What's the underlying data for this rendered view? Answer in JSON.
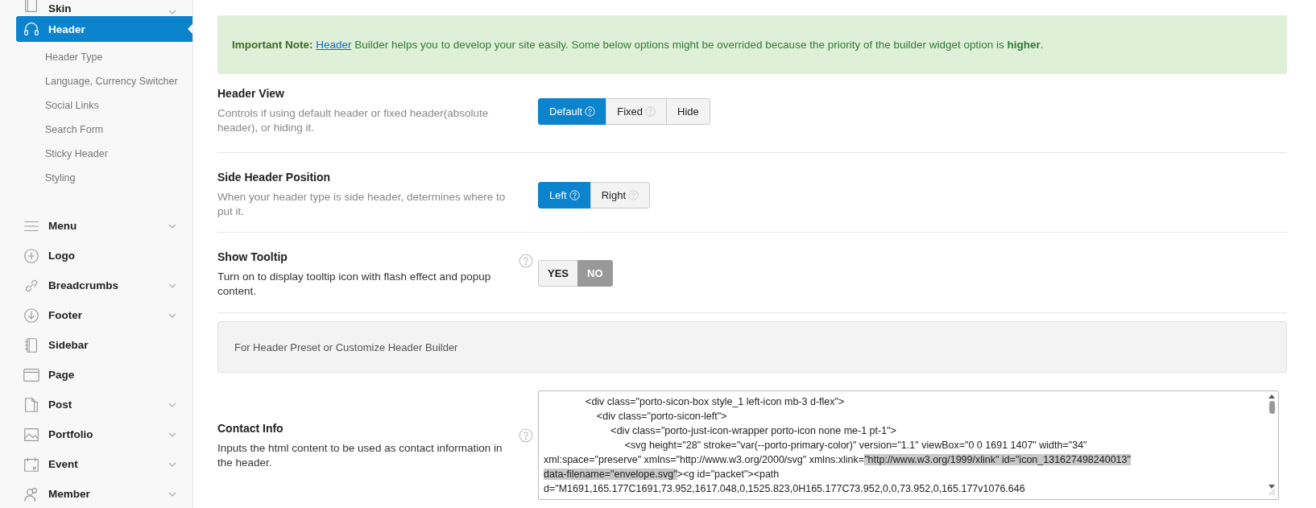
{
  "sidebar": {
    "items": [
      {
        "label": "Skin",
        "selected": false,
        "expandable": true
      },
      {
        "label": "Header",
        "selected": true,
        "expandable": false,
        "children": [
          {
            "label": "Header Type",
            "selected": false
          },
          {
            "label": "Language, Currency Switcher",
            "selected": false
          },
          {
            "label": "Social Links",
            "selected": false
          },
          {
            "label": "Search Form",
            "selected": false
          },
          {
            "label": "Sticky Header",
            "selected": false
          },
          {
            "label": "Styling",
            "selected": false
          }
        ]
      },
      {
        "label": "Menu",
        "selected": false,
        "expandable": true
      },
      {
        "label": "Logo",
        "selected": false,
        "expandable": false
      },
      {
        "label": "Breadcrumbs",
        "selected": false,
        "expandable": true
      },
      {
        "label": "Footer",
        "selected": false,
        "expandable": true
      },
      {
        "label": "Sidebar",
        "selected": false,
        "expandable": false
      },
      {
        "label": "Page",
        "selected": false,
        "expandable": false
      },
      {
        "label": "Post",
        "selected": false,
        "expandable": true
      },
      {
        "label": "Portfolio",
        "selected": false,
        "expandable": true
      },
      {
        "label": "Event",
        "selected": false,
        "expandable": true
      },
      {
        "label": "Member",
        "selected": false,
        "expandable": true
      }
    ]
  },
  "note": {
    "label": "Important Note:",
    "link": "Header",
    "text": "Builder helps you to develop your site easily. Some below options might be overrided because the priority of the builder widget option is **higher**."
  },
  "settings": [
    {
      "kind": "buttons",
      "title": "Header View",
      "description": "Controls if using default header or fixed header(absolute header), or hiding it.",
      "help": false,
      "options": [
        {
          "label": "Default",
          "help": true,
          "selected": true
        },
        {
          "label": "Fixed",
          "help": true,
          "selected": false
        },
        {
          "label": "Hide",
          "help": false,
          "selected": false
        }
      ]
    },
    {
      "kind": "buttons",
      "title": "Side Header Position",
      "description": "When your header type is side header, determines where to put it.",
      "help": false,
      "options": [
        {
          "label": "Left",
          "help": true,
          "selected": true
        },
        {
          "label": "Right",
          "help": true,
          "selected": false
        }
      ]
    },
    {
      "kind": "toggle",
      "title": "Show Tooltip",
      "description": "Turn on to display tooltip icon with flash effect and popup content.",
      "help": true,
      "options": [
        {
          "label": "YES",
          "selected": false
        },
        {
          "label": "NO",
          "selected": true
        }
      ]
    },
    {
      "kind": "info",
      "text": "For Header Preset or Customize Header Builder"
    },
    {
      "kind": "code",
      "title": "Contact Info",
      "description": "Inputs the html content to be used as contact information in the header.",
      "help": true,
      "segments": [
        {
          "text": "               <div class=\"porto-sicon-box style_1 left-icon mb-3 d-flex\">\n                   <div class=\"porto-sicon-left\">\n                        <div class=\"porto-just-icon-wrapper porto-icon none me-1 pt-1\">\n                             <svg height=\"28\" stroke=\"var(--porto-primary-color)\" version=\"1.1\" viewBox=\"0 0 1691 1407\" width=\"34\"\nxml:space=\"preserve\" xmlns=\"http://www.w3.org/2000/svg\" xmlns:xlink=",
          "selected": false
        },
        {
          "text": "\"http://www.w3.org/1999/xlink\" id=\"icon_131627498240013\"\ndata-filename=\"envelope.svg\"",
          "selected": true
        },
        {
          "text": "><g id=\"packet\"><path\nd=\"M1691,165.177C1691,73.952,1617.048,0,1525.823,0H165.177C73.952,0,0,73.952,0,165.177v1076.646",
          "selected": false
        }
      ]
    }
  ]
}
